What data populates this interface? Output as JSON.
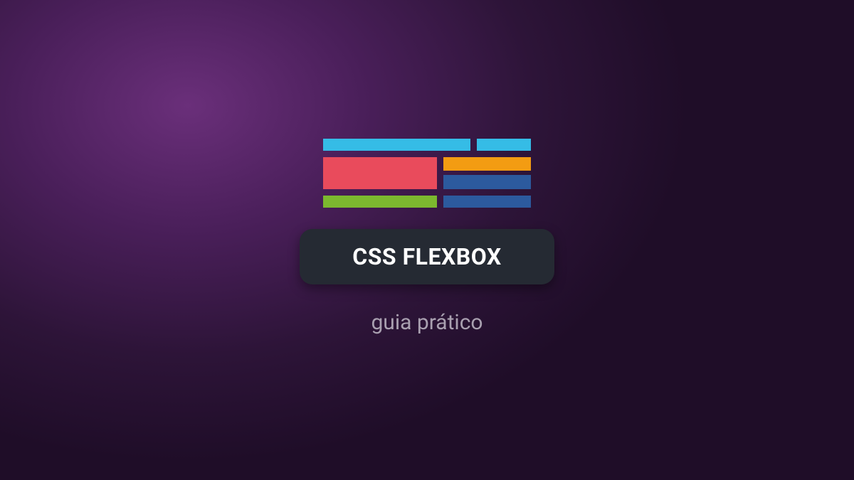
{
  "title": "CSS FLEXBOX",
  "subtitle": "guia prático",
  "colors": {
    "cyan": "#35bce6",
    "red": "#e94b5c",
    "orange": "#f39c12",
    "blue": "#2c5a9e",
    "green": "#7cb82f",
    "pill_bg": "#252a33",
    "subtitle": "#a9a0b0"
  }
}
